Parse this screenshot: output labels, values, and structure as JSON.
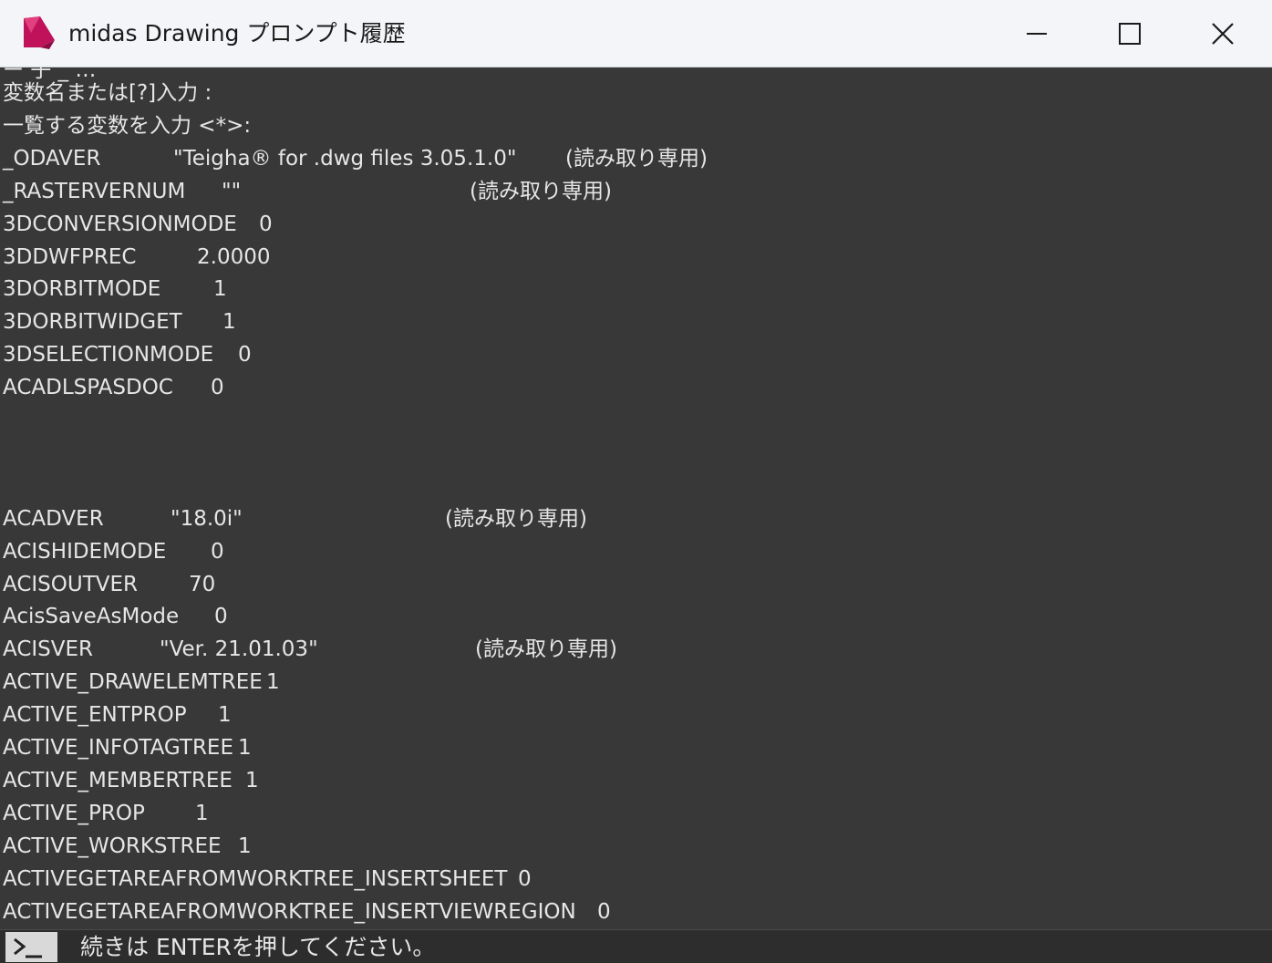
{
  "window": {
    "title": "midas Drawing プロンプト履歴",
    "logo_icon": "midas-drawing-logo",
    "controls": {
      "minimize_icon": "minimize-icon",
      "maximize_icon": "maximize-icon",
      "close_icon": "close-icon"
    }
  },
  "colors": {
    "background": "#383838",
    "text": "#e6e6e6",
    "titlebar": "#f3f5f8",
    "brand": "#c0125b"
  },
  "history": {
    "partial_top_line": "ー 子 _ …",
    "lines": [
      {
        "name": "変数名または[?]入力 :"
      },
      {
        "name": "一覧する変数を入力 <*>:"
      },
      {
        "name": "_ODAVER",
        "value": "\"Teigha® for .dwg files 3.05.1.0\"",
        "note": "(読み取り専用)"
      },
      {
        "name": "_RASTERVERNUM",
        "value": "\"\"",
        "note": "(読み取り専用)"
      },
      {
        "name": "3DCONVERSIONMODE",
        "value": "0"
      },
      {
        "name": "3DDWFPREC",
        "value": "2.0000"
      },
      {
        "name": "3DORBITMODE",
        "value": "1"
      },
      {
        "name": "3DORBITWIDGET",
        "value": "1"
      },
      {
        "name": "3DSELECTIONMODE",
        "value": "0"
      },
      {
        "name": "ACADLSPASDOC",
        "value": "0"
      },
      {
        "name": ""
      },
      {
        "name": ""
      },
      {
        "name": ""
      },
      {
        "name": "ACADVER",
        "value": "\"18.0i\"",
        "note": "(読み取り専用)"
      },
      {
        "name": "ACISHIDEMODE",
        "value": "0"
      },
      {
        "name": "ACISOUTVER",
        "value": "70"
      },
      {
        "name": "AcisSaveAsMode",
        "value": "0"
      },
      {
        "name": "ACISVER",
        "value": "\"Ver. 21.01.03\"",
        "note": "(読み取り専用)"
      },
      {
        "name": "ACTIVE_DRAWELEMTREE",
        "value": "1"
      },
      {
        "name": "ACTIVE_ENTPROP",
        "value": "1"
      },
      {
        "name": "ACTIVE_INFOTAGTREE",
        "value": "1"
      },
      {
        "name": "ACTIVE_MEMBERTREE",
        "value": "1"
      },
      {
        "name": "ACTIVE_PROP",
        "value": "1"
      },
      {
        "name": "ACTIVE_WORKSTREE",
        "value": "1"
      },
      {
        "name": "ACTIVEGETAREAFROMWORKTREE_INSERTSHEET",
        "value": "0"
      },
      {
        "name": "ACTIVEGETAREAFROMWORKTREE_INSERTVIEWREGION",
        "value": "0"
      }
    ]
  },
  "prompt": {
    "icon": "command-prompt-icon",
    "text": "続きは ENTERを押してください。"
  }
}
